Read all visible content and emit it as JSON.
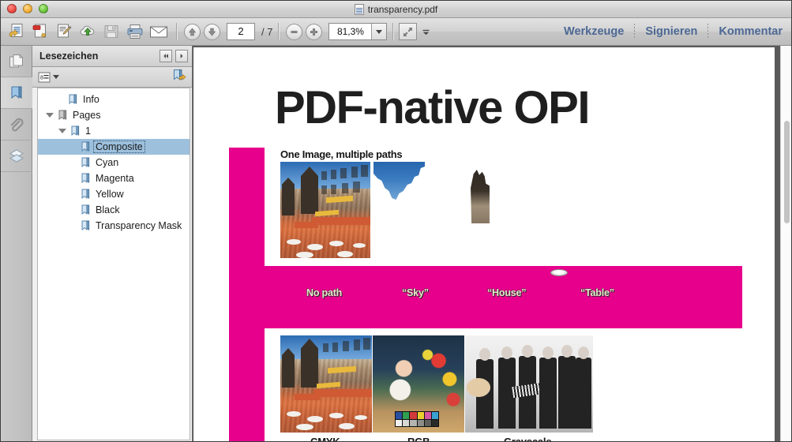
{
  "window": {
    "title": "transparency.pdf",
    "controls": [
      "close",
      "minimize",
      "maximize"
    ]
  },
  "toolbar": {
    "left_tools": [
      {
        "name": "open-previous-document",
        "icon": "document-back-icon"
      },
      {
        "name": "create-pdf",
        "icon": "document-new-icon"
      },
      {
        "name": "edit-pdf",
        "icon": "document-edit-icon"
      },
      {
        "name": "upload-to-cloud",
        "icon": "cloud-upload-icon"
      },
      {
        "name": "save",
        "icon": "floppy-save-icon"
      },
      {
        "name": "print",
        "icon": "printer-icon"
      },
      {
        "name": "email",
        "icon": "envelope-icon"
      }
    ],
    "page_prev_icon": "arrow-up-circle-icon",
    "page_next_icon": "arrow-down-circle-icon",
    "page_current": "2",
    "page_total": "/ 7",
    "zoom_out_icon": "minus-circle-icon",
    "zoom_in_icon": "plus-circle-icon",
    "zoom_value": "81,3%",
    "zoom_dropdown_icon": "chevron-down-icon",
    "fit_page_icon": "fit-page-icon",
    "view_options_icon": "chevron-down-small-icon",
    "menu": [
      {
        "label": "Werkzeuge"
      },
      {
        "label": "Signieren"
      },
      {
        "label": "Kommentar"
      }
    ]
  },
  "sidebar": {
    "rail": [
      {
        "name": "page-thumbnails",
        "icon": "pages-icon",
        "active": false
      },
      {
        "name": "bookmarks",
        "icon": "bookmark-icon",
        "active": true
      },
      {
        "name": "attachments",
        "icon": "paperclip-icon",
        "active": false
      },
      {
        "name": "layers",
        "icon": "layers-icon",
        "active": false
      }
    ],
    "panel_title": "Lesezeichen",
    "collapse_icon": "double-chevron-left-icon",
    "expand_icon": "chevron-right-icon",
    "options_icon": "options-list-icon",
    "options_caret_icon": "chevron-down-icon",
    "new-bookmark_icon": "new-bookmark-icon",
    "tree": [
      {
        "label": "Info",
        "depth": 1,
        "twisty": "none",
        "selected": false
      },
      {
        "label": "Pages",
        "depth": 0,
        "twisty": "open",
        "selected": false
      },
      {
        "label": "1",
        "depth": 1,
        "twisty": "open",
        "selected": false
      },
      {
        "label": "Composite",
        "depth": 2,
        "twisty": "none",
        "selected": true
      },
      {
        "label": "Cyan",
        "depth": 2,
        "twisty": "none",
        "selected": false
      },
      {
        "label": "Magenta",
        "depth": 2,
        "twisty": "none",
        "selected": false
      },
      {
        "label": "Yellow",
        "depth": 2,
        "twisty": "none",
        "selected": false
      },
      {
        "label": "Black",
        "depth": 2,
        "twisty": "none",
        "selected": false
      },
      {
        "label": "Transparency Mask",
        "depth": 2,
        "twisty": "none",
        "selected": false
      }
    ]
  },
  "document": {
    "heading": "PDF-native OPI",
    "subheading": "One Image, multiple paths",
    "accent_color": "#e6008c",
    "path_labels": [
      {
        "text": "No path"
      },
      {
        "text": "“Sky”"
      },
      {
        "text": "“House”"
      },
      {
        "text": "“Table”"
      }
    ],
    "colorspace_captions": [
      {
        "text": "CMYK"
      },
      {
        "text": "RGB"
      },
      {
        "text": "Grayscale"
      }
    ]
  },
  "scrollbar": {
    "name": "vertical-scrollbar"
  }
}
